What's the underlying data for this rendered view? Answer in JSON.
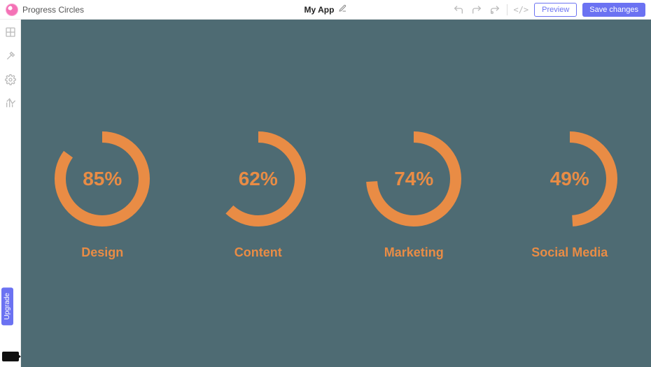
{
  "colors": {
    "accent": "#e98c45",
    "primary": "#6b72f2",
    "canvas_bg": "#4e6b73"
  },
  "topbar": {
    "breadcrumb": "Progress Circles",
    "app_name": "My App",
    "preview_label": "Preview",
    "save_label": "Save changes"
  },
  "sidebar": {
    "upgrade_label": "Upgrade"
  },
  "chart_data": {
    "type": "pie",
    "title": "Progress Circles",
    "series": [
      {
        "name": "Design",
        "values": [
          85
        ]
      },
      {
        "name": "Content",
        "values": [
          62
        ]
      },
      {
        "name": "Marketing",
        "values": [
          74
        ]
      },
      {
        "name": "Social Media",
        "values": [
          49
        ]
      }
    ],
    "ylim": [
      0,
      100
    ]
  },
  "circles": [
    {
      "label": "Design",
      "percent": 85,
      "display": "85%"
    },
    {
      "label": "Content",
      "percent": 62,
      "display": "62%"
    },
    {
      "label": "Marketing",
      "percent": 74,
      "display": "74%"
    },
    {
      "label": "Social Media",
      "percent": 49,
      "display": "49%"
    }
  ]
}
